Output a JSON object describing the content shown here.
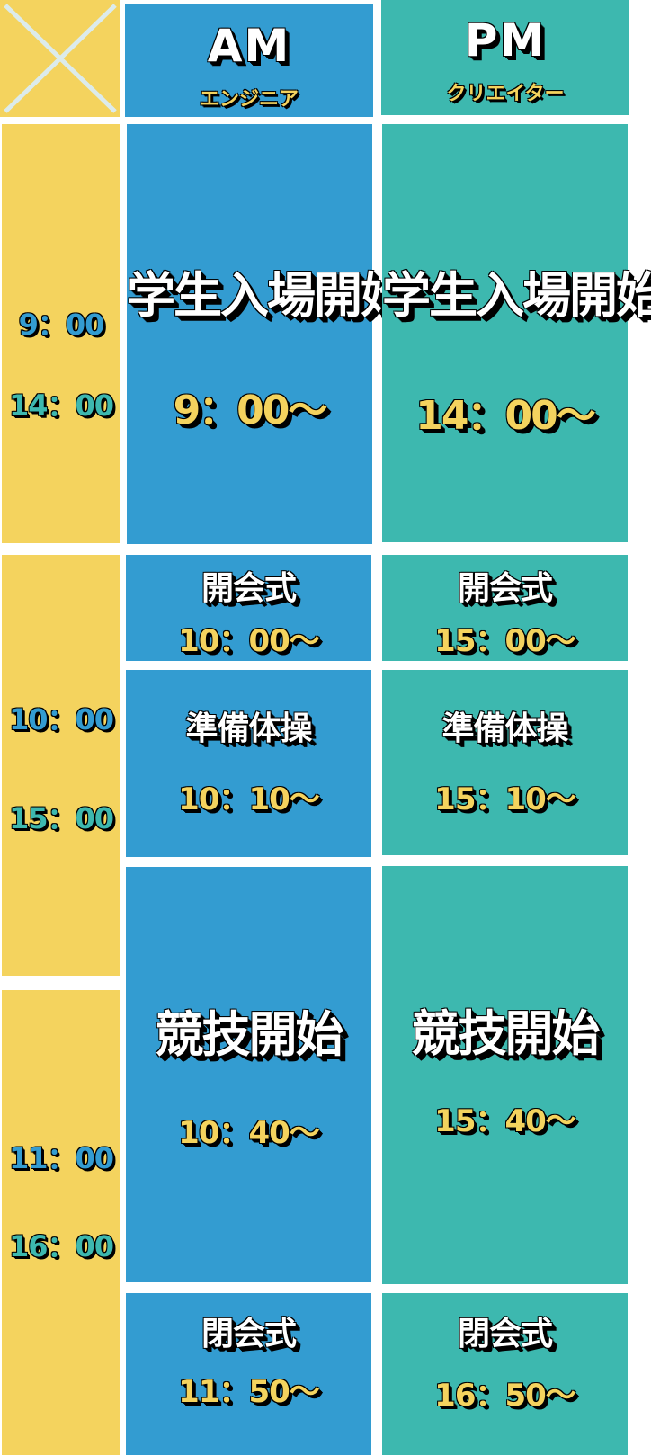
{
  "colors": {
    "yellow": "#F4D35E",
    "blue": "#339CD1",
    "teal": "#3DB8AF"
  },
  "header": {
    "corner_icon": "cross-icon",
    "am": {
      "title": "AM",
      "subtitle": "エンジニア"
    },
    "pm": {
      "title": "PM",
      "subtitle": "クリエイター"
    }
  },
  "time_column": [
    {
      "am_time": "9：00",
      "pm_time": "14：00"
    },
    {
      "am_time": "10：00",
      "pm_time": "15：00"
    },
    {
      "am_time": "11：00",
      "pm_time": "16：00"
    }
  ],
  "am": {
    "entry": {
      "label": "学生入場開始",
      "time": "9：00～"
    },
    "opening": {
      "label": "開会式",
      "time": "10：00～"
    },
    "warmup": {
      "label": "準備体操",
      "time": "10：10～"
    },
    "competition": {
      "label": "競技開始",
      "time": "10：40～"
    },
    "closing": {
      "label": "閉会式",
      "time": "11：50～"
    }
  },
  "pm": {
    "entry": {
      "label": "学生入場開始",
      "time": "14：00～"
    },
    "opening": {
      "label": "開会式",
      "time": "15：00～"
    },
    "warmup": {
      "label": "準備体操",
      "time": "15：10～"
    },
    "competition": {
      "label": "競技開始",
      "time": "15：40～"
    },
    "closing": {
      "label": "閉会式",
      "time": "16：50～"
    }
  }
}
